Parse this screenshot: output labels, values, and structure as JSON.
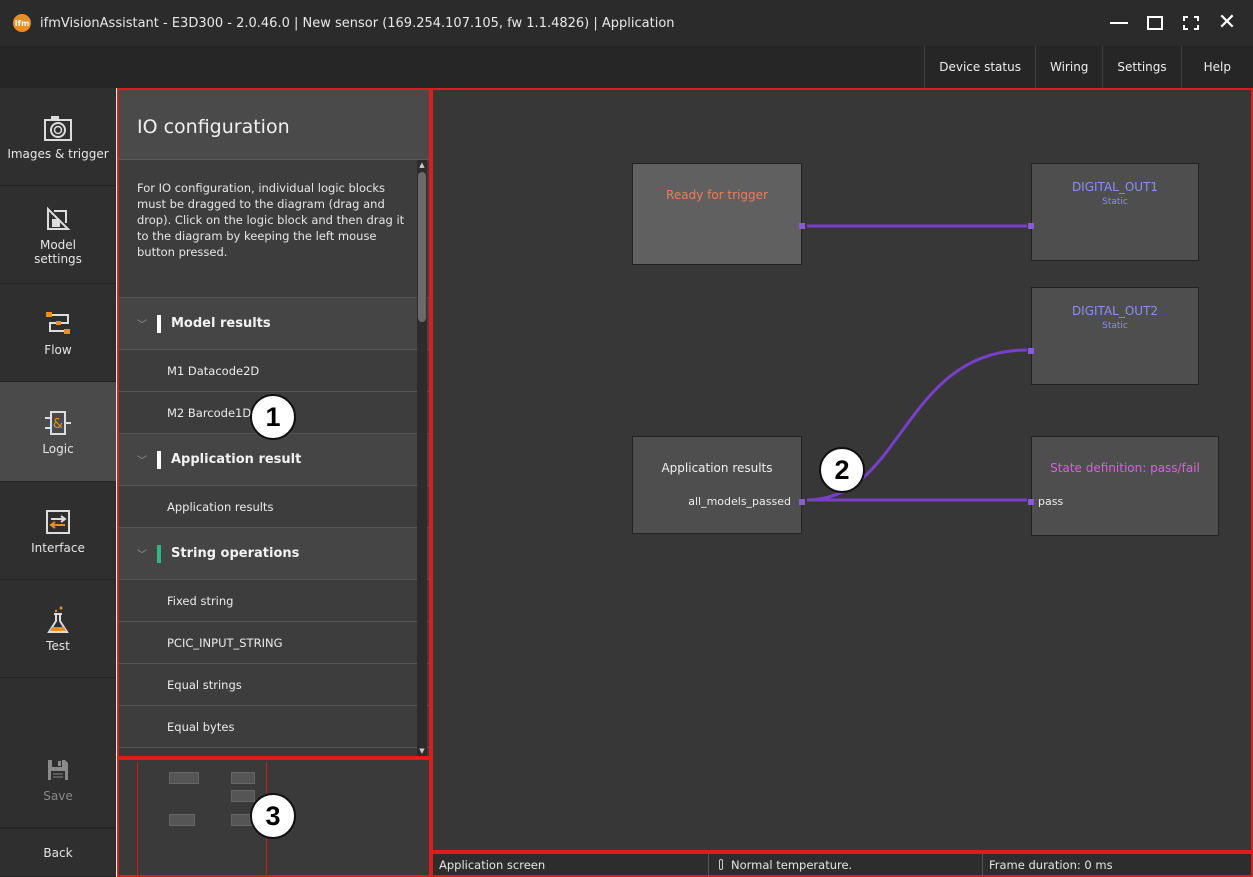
{
  "window": {
    "title": "ifmVisionAssistant - E3D300 - 2.0.46.0 | New sensor (169.254.107.105, fw 1.1.4826) | Application",
    "logo_text": "ifm"
  },
  "menu": [
    "Device status",
    "Wiring",
    "Settings",
    "Help"
  ],
  "nav": [
    {
      "label": "Images & trigger",
      "icon": "camera-icon"
    },
    {
      "label": "Model settings",
      "icon": "model-settings-icon"
    },
    {
      "label": "Flow",
      "icon": "flow-icon"
    },
    {
      "label": "Logic",
      "icon": "logic-icon",
      "active": true
    },
    {
      "label": "Interface",
      "icon": "interface-icon"
    },
    {
      "label": "Test",
      "icon": "flask-icon"
    },
    {
      "label": "Save",
      "icon": "save-icon",
      "disabled": true
    },
    {
      "label": "Back"
    }
  ],
  "panel": {
    "title": "IO configuration",
    "description": "For IO configuration, individual logic blocks must be dragged to the diagram (drag and drop). Click on the logic block and then drag it to the diagram by keeping the left mouse button pressed.",
    "sections": [
      {
        "label": "Model results",
        "items": [
          "M1 Datacode2D",
          "M2 Barcode1D"
        ]
      },
      {
        "label": "Application result",
        "items": [
          "Application results"
        ]
      },
      {
        "label": "String operations",
        "items": [
          "Fixed string",
          "PCIC_INPUT_STRING",
          "Equal strings",
          "Equal bytes"
        ]
      }
    ]
  },
  "diagram": {
    "ready": {
      "title": "Ready for trigger",
      "color": "#f07a5a"
    },
    "out1": {
      "title": "DIGITAL_OUT1",
      "sub": "Static",
      "color": "#8c8ff0"
    },
    "out2": {
      "title": "DIGITAL_OUT2",
      "sub": "Static",
      "color": "#8c8ff0"
    },
    "app": {
      "title": "Application results",
      "port": "all_models_passed"
    },
    "state": {
      "title": "State definition: pass/fail",
      "port": "pass",
      "color": "#d85fe0"
    },
    "wire_color": "#7a3fc8"
  },
  "status": {
    "screen": "Application screen",
    "temperature": "Normal temperature.",
    "frame": "Frame duration: 0 ms"
  },
  "callouts": [
    "1",
    "2",
    "3"
  ]
}
